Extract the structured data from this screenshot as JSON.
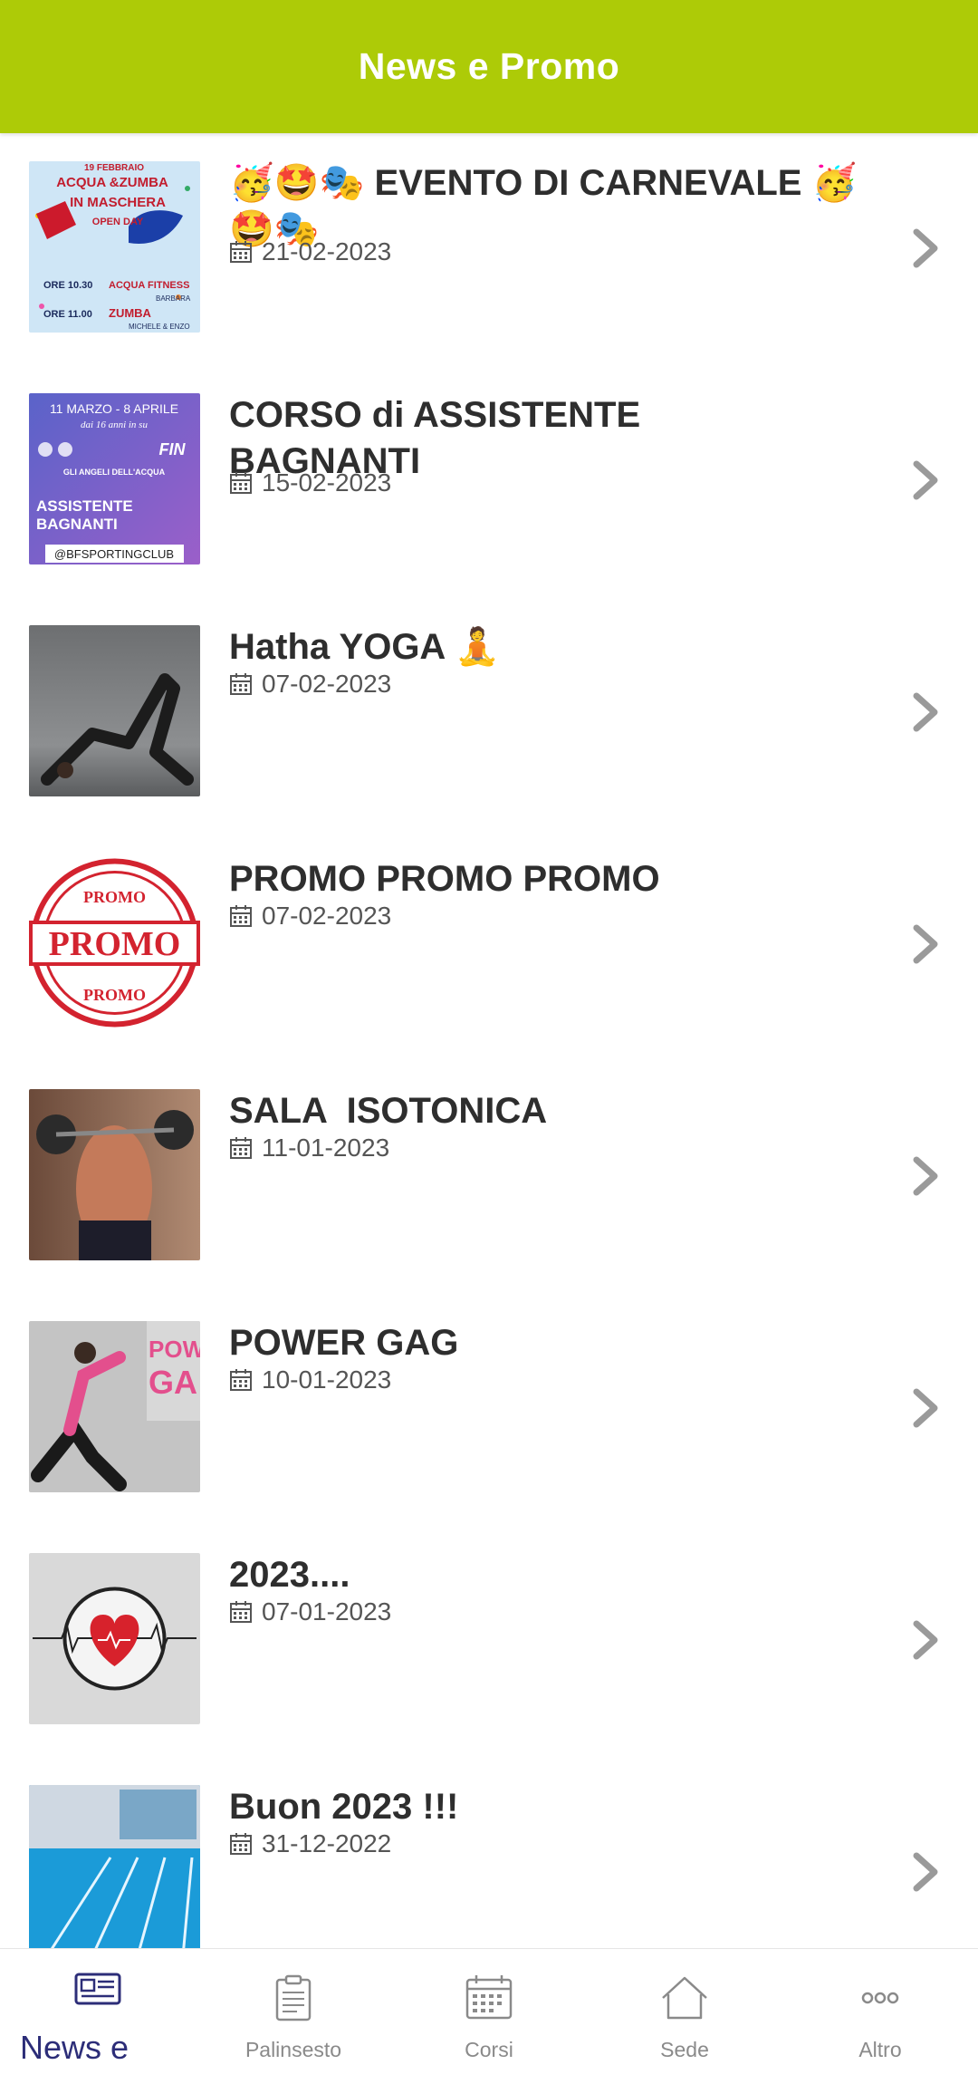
{
  "header": {
    "title": "News e Promo"
  },
  "news": [
    {
      "title": "🥳🤩🎭 EVENTO DI CARNEVALE 🥳🤩🎭",
      "date": "21-02-2023",
      "thumb": "carnival-poster"
    },
    {
      "title": "CORSO di ASSISTENTE BAGNANTI",
      "date": "15-02-2023",
      "thumb": "lifeguard-poster"
    },
    {
      "title": "Hatha YOGA 🧘",
      "date": "07-02-2023",
      "thumb": "yoga-photo"
    },
    {
      "title": "PROMO PROMO PROMO",
      "date": "07-02-2023",
      "thumb": "promo-stamp"
    },
    {
      "title": "SALA  ISOTONICA",
      "date": "11-01-2023",
      "thumb": "weights-photo"
    },
    {
      "title": "POWER GAG",
      "date": "10-01-2023",
      "thumb": "running-photo"
    },
    {
      "title": "2023....",
      "date": "07-01-2023",
      "thumb": "heartbeat-graphic"
    },
    {
      "title": "Buon 2023 !!!",
      "date": "31-12-2022",
      "thumb": "pool-photo"
    }
  ],
  "thumb_text": {
    "carnival": [
      "19 FEBBRAIO",
      "ACQUA &ZUMBA",
      "IN MASCHERA",
      "OPEN DAY",
      "ORE 10.30",
      "ACQUA FITNESS",
      "BARBARA",
      "ORE 11.00",
      "ZUMBA",
      "MICHELE & ENZO"
    ],
    "lifeguard": [
      "11 MARZO - 8 APRILE",
      "dai 16 anni in su",
      "FIN",
      "GLI ANGELI DELL'ACQUA",
      "ASSISTENTE",
      "BAGNANTI",
      "@BFSPORTINGCLUB"
    ],
    "promo": [
      "PROMO",
      "PROMO",
      "PROMO"
    ],
    "power": [
      "POW",
      "GA"
    ]
  },
  "tabs": [
    {
      "label": "News e",
      "icon": "newspaper-icon",
      "active": true
    },
    {
      "label": "Palinsesto",
      "icon": "clipboard-icon",
      "active": false
    },
    {
      "label": "Corsi",
      "icon": "calendar-icon",
      "active": false
    },
    {
      "label": "Sede",
      "icon": "home-icon",
      "active": false
    },
    {
      "label": "Altro",
      "icon": "more-icon",
      "active": false
    }
  ],
  "colors": {
    "accent": "#adcb07",
    "active_tab": "#2c2d78",
    "inactive_tab": "#8a8a8a",
    "title": "#2e2e2e"
  }
}
